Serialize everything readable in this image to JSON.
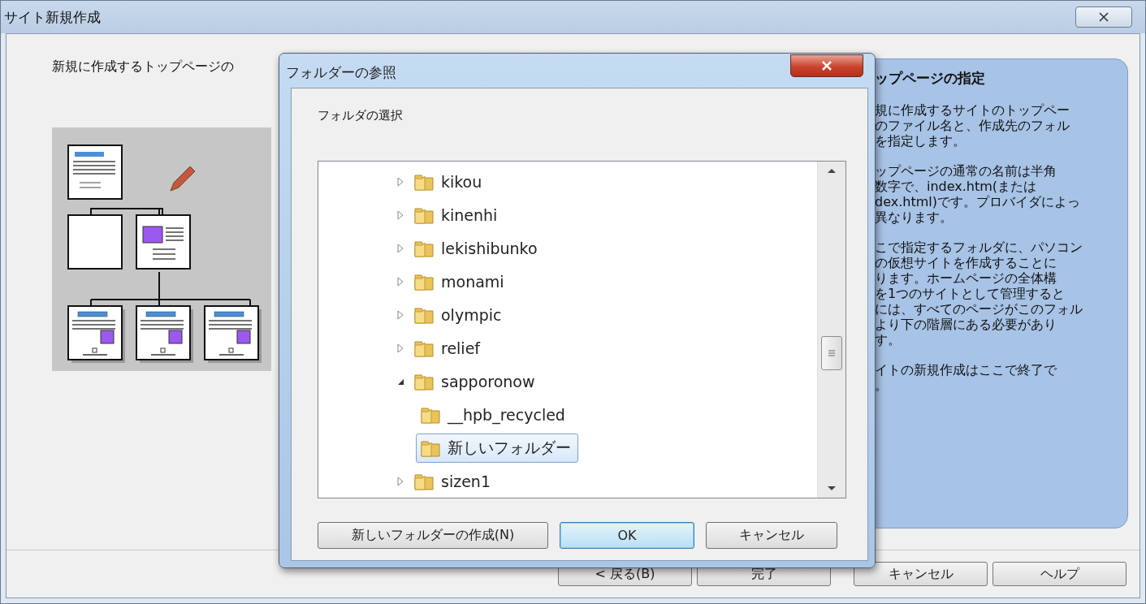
{
  "window": {
    "title": "サイト新規作成"
  },
  "intro": "新規に作成するトップページの",
  "help_panel": {
    "title": "ップページの指定",
    "paragraphs": [
      [
        "規に作成するサイトのトップペー",
        "のファイル名と、作成先のフォル",
        "を指定します。"
      ],
      [
        "ップページの通常の名前は半角",
        "数字で、index.htm(または",
        "dex.html)です。プロバイダによっ",
        "異なります。"
      ],
      [
        "こで指定するフォルダに、パソコン",
        "の仮想サイトを作成することに",
        "ります。ホームページの全体構",
        "を1つのサイトとして管理すると",
        "には、すべてのページがこのフォル",
        "より下の階層にある必要があり",
        "す。"
      ],
      [
        "イトの新規作成はここで終了で",
        "。"
      ]
    ]
  },
  "buttons": [
    {
      "label": "< 戻る(B)"
    },
    {
      "label": "完了"
    },
    {
      "label": "キャンセル"
    },
    {
      "label": "ヘルプ"
    }
  ],
  "dialog": {
    "title": "フォルダーの参照",
    "prompt": "フォルダの選択",
    "tree": [
      {
        "label": "kikou",
        "expanded": false,
        "selected": false
      },
      {
        "label": "kinenhi",
        "expanded": false,
        "selected": false
      },
      {
        "label": "lekishibunko",
        "expanded": false,
        "selected": false
      },
      {
        "label": "monami",
        "expanded": false,
        "selected": false
      },
      {
        "label": "olympic",
        "expanded": false,
        "selected": false
      },
      {
        "label": "relief",
        "expanded": false,
        "selected": false
      },
      {
        "label": "sapporonow",
        "expanded": true,
        "selected": false,
        "children": [
          {
            "label": "__hpb_recycled",
            "selected": false
          },
          {
            "label": "新しいフォルダー",
            "selected": true
          }
        ]
      },
      {
        "label": "sizen1",
        "expanded": false,
        "selected": false
      }
    ],
    "buttons": [
      {
        "label": "新しいフォルダーの作成(N)",
        "default": false
      },
      {
        "label": "OK",
        "default": true
      },
      {
        "label": "キャンセル",
        "default": false
      }
    ]
  }
}
